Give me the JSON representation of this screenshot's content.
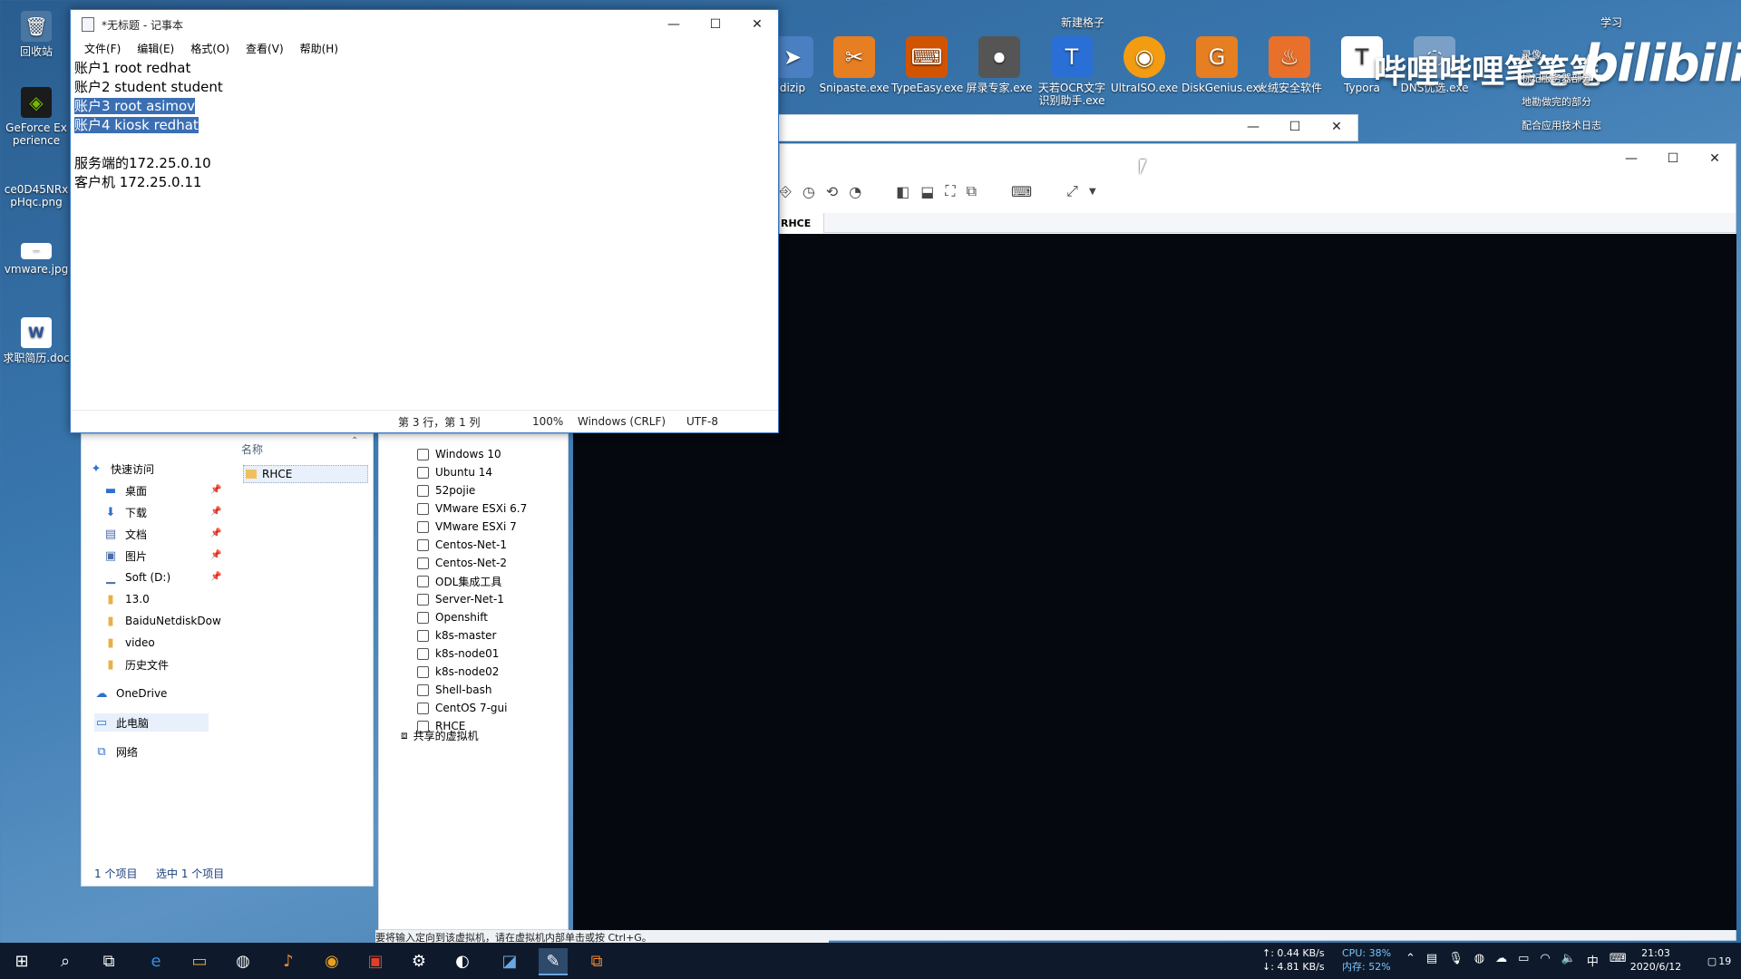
{
  "desktop": {
    "icons": [
      {
        "label": "回收站"
      },
      {
        "label": "GeForce Experience"
      },
      {
        "label": "ce0D45NRxpHqc.png"
      },
      {
        "label": "vmware.jpg"
      },
      {
        "label": "求职简历.doc"
      }
    ],
    "top_right": {
      "folder_label": "新建格子",
      "study_label": "学习",
      "brand_text": "哔哩哔哩笔笔笔",
      "brand_logo": "bilibili",
      "tiles": [
        {
          "label": "dizip",
          "icon": "arrow-icon",
          "color": "#4a7fc1"
        },
        {
          "label": "Snipaste.exe",
          "icon": "snipaste-icon",
          "color": "#e67e22"
        },
        {
          "label": "TypeEasy.exe",
          "icon": "typeeasy-icon",
          "color": "#d35400"
        },
        {
          "label": "屏录专家.exe",
          "icon": "screen-recorder-icon",
          "color": "#555555"
        },
        {
          "label": "天若OCR文字识别助手.exe",
          "icon": "ocr-icon",
          "color": "#2a6fd6"
        },
        {
          "label": "UltraISO.exe",
          "icon": "disc-icon",
          "color": "#f39c12"
        },
        {
          "label": "DiskGenius.exe",
          "icon": "diskgenius-icon",
          "color": "#e67e22"
        },
        {
          "label": "火绒安全软件",
          "icon": "huorong-icon",
          "color": "#e8702a"
        },
        {
          "label": "Typora",
          "icon": "typora-icon",
          "color": "#ffffff"
        },
        {
          "label": "DNS优选.exe",
          "icon": "dns-icon",
          "color": "#7aa0c8"
        }
      ],
      "shortcuts": [
        "录像",
        "标记服务器部分",
        "地勘做完的部分",
        "配合应用技术日志"
      ]
    }
  },
  "notepad": {
    "title": "*无标题 - 记事本",
    "menu": [
      "文件(F)",
      "编辑(E)",
      "格式(O)",
      "查看(V)",
      "帮助(H)"
    ],
    "lines": [
      {
        "text": "账户1 root redhat",
        "selected": false
      },
      {
        "text": "账户2 student student",
        "selected": false
      },
      {
        "text": "账户3 root asimov",
        "selected": true
      },
      {
        "text": "账户4 kiosk redhat",
        "selected": true
      },
      {
        "text": "",
        "selected": false
      },
      {
        "text": "服务端的172.25.0.10",
        "selected": false
      },
      {
        "text": "客户机 172.25.0.11",
        "selected": false
      }
    ],
    "status": {
      "position": "第 3 行，第 1 列",
      "zoom": "100%",
      "line_ending": "Windows (CRLF)",
      "encoding": "UTF-8"
    }
  },
  "explorer": {
    "column_header": "名称",
    "file_item": "RHCE",
    "nav": [
      {
        "label": "快速访问",
        "icon": "pin-icon",
        "pinned": false
      },
      {
        "label": "桌面",
        "icon": "desktop-icon",
        "pinned": true
      },
      {
        "label": "下载",
        "icon": "download-icon",
        "pinned": true
      },
      {
        "label": "文档",
        "icon": "document-icon",
        "pinned": true
      },
      {
        "label": "图片",
        "icon": "picture-icon",
        "pinned": true
      },
      {
        "label": "Soft (D:)",
        "icon": "drive-icon",
        "pinned": true
      },
      {
        "label": "13.0",
        "icon": "folder-icon",
        "pinned": false
      },
      {
        "label": "BaiduNetdiskDow",
        "icon": "folder-icon",
        "pinned": false
      },
      {
        "label": "video",
        "icon": "folder-icon",
        "pinned": false
      },
      {
        "label": "历史文件",
        "icon": "folder-icon",
        "pinned": false
      },
      {
        "label": "OneDrive",
        "icon": "cloud-icon",
        "pinned": false
      },
      {
        "label": "此电脑",
        "icon": "computer-icon",
        "pinned": false
      },
      {
        "label": "网络",
        "icon": "network-icon",
        "pinned": false
      }
    ],
    "status_count": "1 个项目",
    "status_selected": "选中 1 个项目"
  },
  "vm_library": {
    "items": [
      "Windows 10",
      "Ubuntu 14",
      "52pojie",
      "VMware ESXi 6.7",
      "VMware ESXi 7",
      "Centos-Net-1",
      "Centos-Net-2",
      "ODL集成工具",
      "Server-Net-1",
      "Openshift",
      "k8s-master",
      "k8s-node01",
      "k8s-node02",
      "Shell-bash",
      "CentOS 7-gui",
      "RHCE"
    ],
    "shared": "共享的虚拟机",
    "hint": "要将输入定向到该虚拟机，请在虚拟机内部单击或按 Ctrl+G。"
  },
  "vmware": {
    "tab": "RHCE"
  },
  "taskbar": {
    "net_up": "↑: 0.44 KB/s",
    "net_down": "↓: 4.81 KB/s",
    "cpu": "CPU: 38%",
    "mem": "内存: 52%",
    "ime": "中",
    "time": "21:03",
    "date": "2020/6/12",
    "notif_count": "19"
  }
}
